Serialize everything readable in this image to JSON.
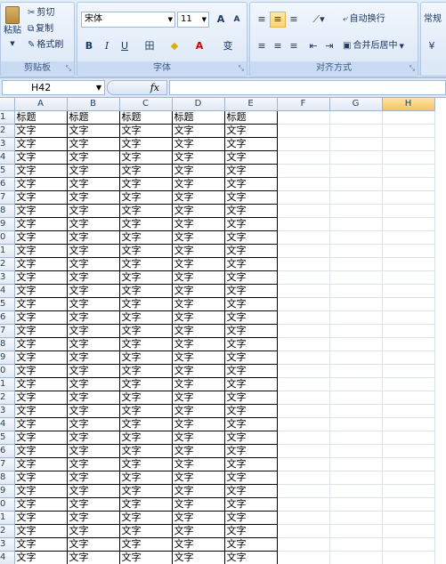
{
  "ribbon": {
    "clipboard": {
      "paste": "粘贴",
      "cut": "剪切",
      "copy": "复制",
      "format_painter": "格式刷",
      "caption": "剪贴板"
    },
    "font": {
      "name": "宋体",
      "size": "11",
      "grow": "A",
      "shrink": "A",
      "bold": "B",
      "italic": "I",
      "underline": "U",
      "border": "田",
      "fill": "◆",
      "color": "A",
      "phonetic": "变",
      "caption": "字体"
    },
    "align": {
      "wrap": "自动换行",
      "merge": "合并后居中",
      "caption": "对齐方式"
    },
    "number": {
      "format": "常规"
    }
  },
  "formula_bar": {
    "name_box": "H42",
    "fx": "fx",
    "value": ""
  },
  "columns": [
    "A",
    "B",
    "C",
    "D",
    "E",
    "F",
    "G",
    "H"
  ],
  "selected_column": "H",
  "rows": [
    {
      "num": "1",
      "cells": [
        "标题",
        "标题",
        "标题",
        "标题",
        "标题"
      ]
    },
    {
      "num": "2",
      "cells": [
        "文字",
        "文字",
        "文字",
        "文字",
        "文字"
      ]
    },
    {
      "num": "3",
      "cells": [
        "文字",
        "文字",
        "文字",
        "文字",
        "文字"
      ]
    },
    {
      "num": "4",
      "cells": [
        "文字",
        "文字",
        "文字",
        "文字",
        "文字"
      ]
    },
    {
      "num": "5",
      "cells": [
        "文字",
        "文字",
        "文字",
        "文字",
        "文字"
      ]
    },
    {
      "num": "6",
      "cells": [
        "文字",
        "文字",
        "文字",
        "文字",
        "文字"
      ]
    },
    {
      "num": "7",
      "cells": [
        "文字",
        "文字",
        "文字",
        "文字",
        "文字"
      ]
    },
    {
      "num": "8",
      "cells": [
        "文字",
        "文字",
        "文字",
        "文字",
        "文字"
      ]
    },
    {
      "num": "9",
      "cells": [
        "文字",
        "文字",
        "文字",
        "文字",
        "文字"
      ]
    },
    {
      "num": "0",
      "cells": [
        "文字",
        "文字",
        "文字",
        "文字",
        "文字"
      ]
    },
    {
      "num": "1",
      "cells": [
        "文字",
        "文字",
        "文字",
        "文字",
        "文字"
      ]
    },
    {
      "num": "2",
      "cells": [
        "文字",
        "文字",
        "文字",
        "文字",
        "文字"
      ]
    },
    {
      "num": "3",
      "cells": [
        "文字",
        "文字",
        "文字",
        "文字",
        "文字"
      ]
    },
    {
      "num": "4",
      "cells": [
        "文字",
        "文字",
        "文字",
        "文字",
        "文字"
      ]
    },
    {
      "num": "5",
      "cells": [
        "文字",
        "文字",
        "文字",
        "文字",
        "文字"
      ]
    },
    {
      "num": "6",
      "cells": [
        "文字",
        "文字",
        "文字",
        "文字",
        "文字"
      ]
    },
    {
      "num": "7",
      "cells": [
        "文字",
        "文字",
        "文字",
        "文字",
        "文字"
      ]
    },
    {
      "num": "8",
      "cells": [
        "文字",
        "文字",
        "文字",
        "文字",
        "文字"
      ]
    },
    {
      "num": "9",
      "cells": [
        "文字",
        "文字",
        "文字",
        "文字",
        "文字"
      ]
    },
    {
      "num": "0",
      "cells": [
        "文字",
        "文字",
        "文字",
        "文字",
        "文字"
      ]
    },
    {
      "num": "1",
      "cells": [
        "文字",
        "文字",
        "文字",
        "文字",
        "文字"
      ]
    },
    {
      "num": "2",
      "cells": [
        "文字",
        "文字",
        "文字",
        "文字",
        "文字"
      ]
    },
    {
      "num": "3",
      "cells": [
        "文字",
        "文字",
        "文字",
        "文字",
        "文字"
      ]
    },
    {
      "num": "4",
      "cells": [
        "文字",
        "文字",
        "文字",
        "文字",
        "文字"
      ]
    },
    {
      "num": "5",
      "cells": [
        "文字",
        "文字",
        "文字",
        "文字",
        "文字"
      ]
    },
    {
      "num": "6",
      "cells": [
        "文字",
        "文字",
        "文字",
        "文字",
        "文字"
      ]
    },
    {
      "num": "7",
      "cells": [
        "文字",
        "文字",
        "文字",
        "文字",
        "文字"
      ]
    },
    {
      "num": "8",
      "cells": [
        "文字",
        "文字",
        "文字",
        "文字",
        "文字"
      ]
    },
    {
      "num": "9",
      "cells": [
        "文字",
        "文字",
        "文字",
        "文字",
        "文字"
      ]
    },
    {
      "num": "0",
      "cells": [
        "文字",
        "文字",
        "文字",
        "文字",
        "文字"
      ]
    },
    {
      "num": "1",
      "cells": [
        "文字",
        "文字",
        "文字",
        "文字",
        "文字"
      ]
    },
    {
      "num": "2",
      "cells": [
        "文字",
        "文字",
        "文字",
        "文字",
        "文字"
      ]
    },
    {
      "num": "3",
      "cells": [
        "文字",
        "文字",
        "文字",
        "文字",
        "文字"
      ]
    },
    {
      "num": "4",
      "cells": [
        "文字",
        "文字",
        "文字",
        "文字",
        "文字"
      ]
    },
    {
      "num": "5",
      "cells": [
        "文字",
        "文字",
        "文字",
        "文字",
        "文字"
      ]
    }
  ]
}
